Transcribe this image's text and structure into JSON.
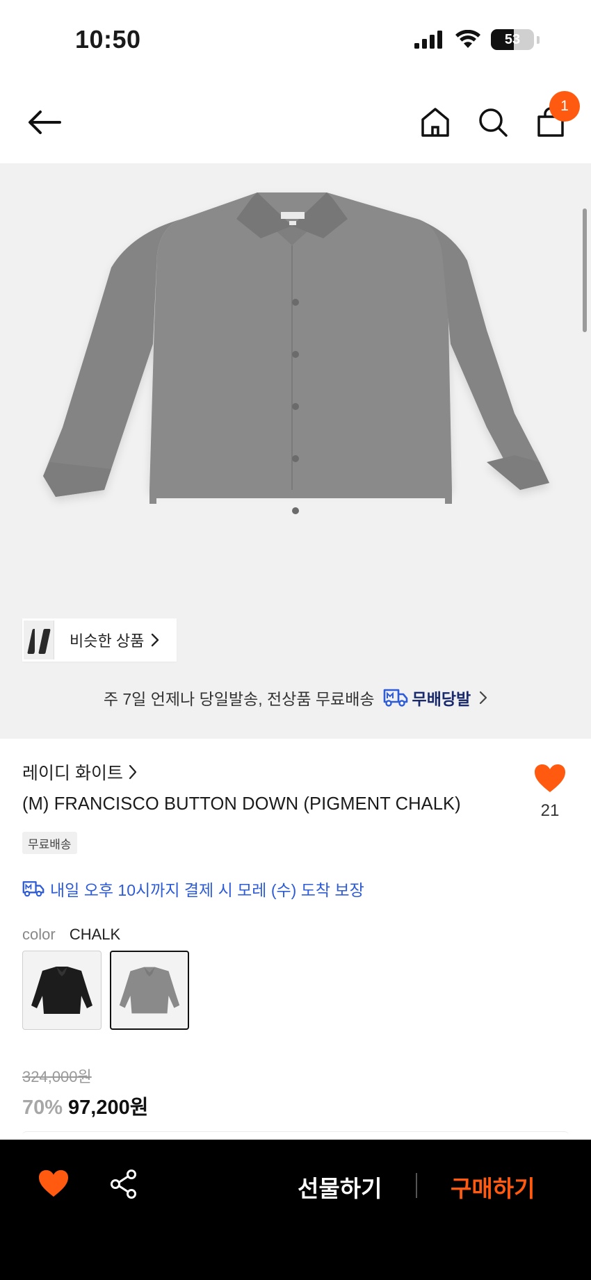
{
  "status_bar": {
    "time": "10:50",
    "battery_level": "53",
    "icons": [
      "cellular-signal-icon",
      "wifi-icon",
      "battery-icon"
    ]
  },
  "nav": {
    "icons": [
      "back-arrow-icon",
      "home-icon",
      "search-icon",
      "shopping-bag-icon"
    ],
    "cart_count": "1"
  },
  "hero": {
    "image": "gray-button-down-shirt",
    "similar_label": "비슷한 상품",
    "shipping_text": "주 7일 언제나 당일발송, 전상품 무료배송",
    "shipping_brand": "무배당발"
  },
  "product": {
    "brand": "레이디 화이트",
    "name": "(M) FRANCISCO BUTTON DOWN (PIGMENT CHALK)",
    "like_count": "21",
    "free_shipping_tag": "무료배송",
    "delivery_notice": "내일 오후 10시까지 결제 시 모레 (수) 도착 보장",
    "color_label": "color",
    "color_value": "CHALK",
    "colors": [
      {
        "name": "black",
        "hex": "#1c1c1c",
        "selected": false
      },
      {
        "name": "chalk",
        "hex": "#8a8a8a",
        "selected": true
      }
    ],
    "original_price": "324,000원",
    "discount": "70%",
    "price": "97,200원"
  },
  "bottom_bar": {
    "gift_label": "선물하기",
    "buy_label": "구매하기"
  },
  "colors": {
    "accent": "#ff5a0f",
    "delivery_blue": "#2e5bd6",
    "shirt_gray": "#8a8a8a"
  }
}
